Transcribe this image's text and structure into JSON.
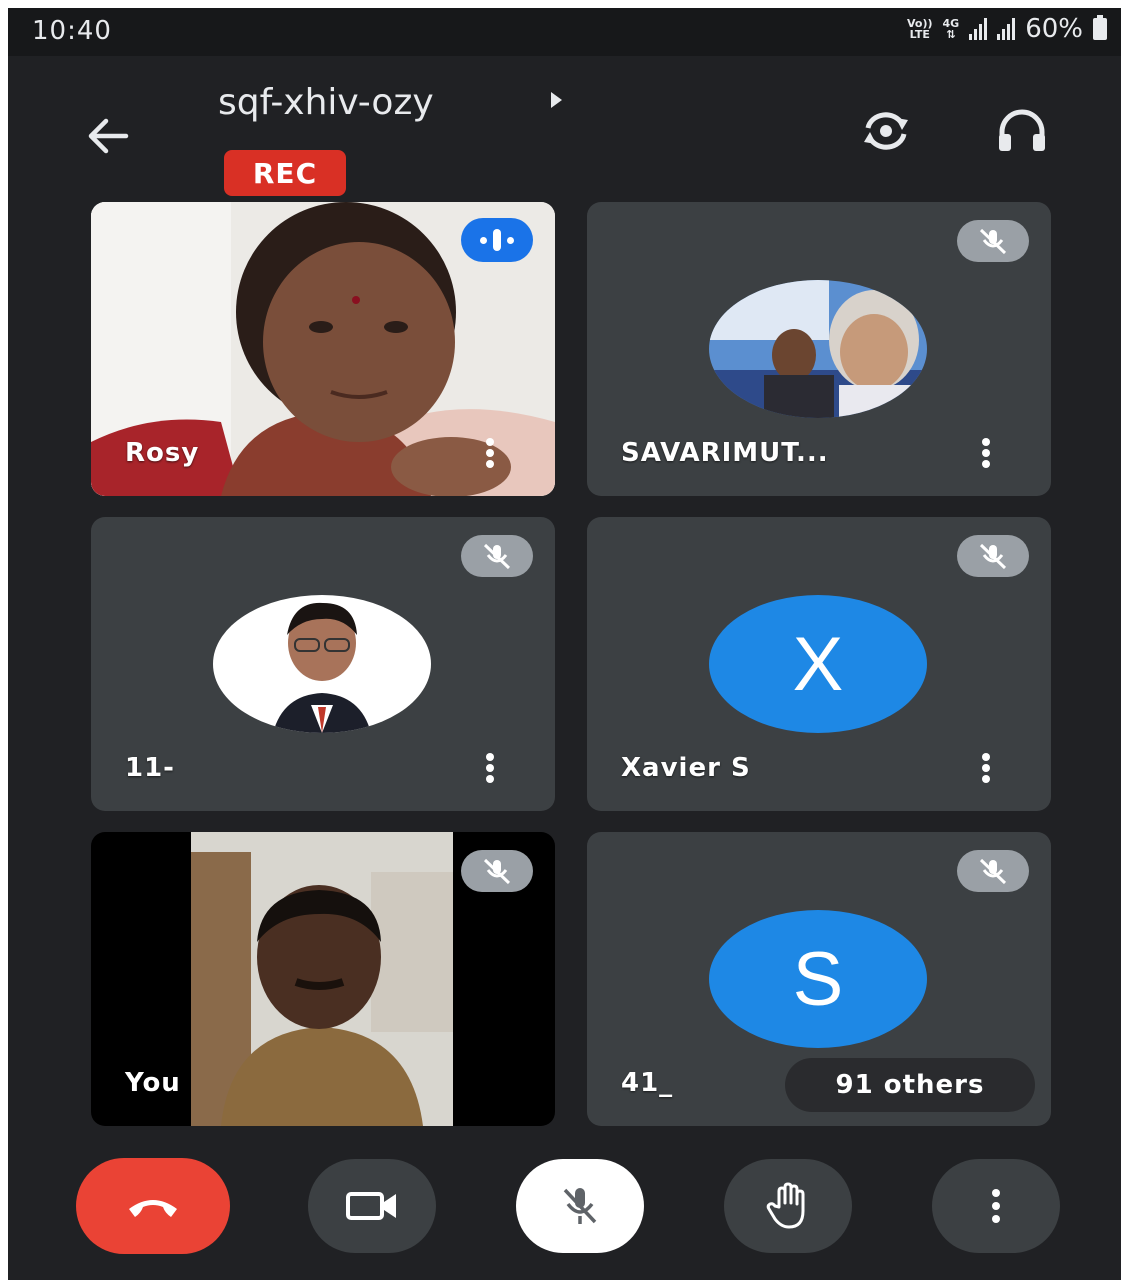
{
  "status_bar": {
    "time": "10:40",
    "volte_top": "Vo))",
    "volte_bottom": "LTE",
    "network": "4G",
    "battery": "60%"
  },
  "header": {
    "meeting_code": "sqf-xhiv-ozy",
    "rec_label": "REC"
  },
  "tiles": [
    {
      "name": "Rosy",
      "status": "speaking"
    },
    {
      "name": "SAVARIMUT...",
      "status": "muted"
    },
    {
      "name": "11-",
      "status": "muted"
    },
    {
      "name": "Xavier S",
      "status": "muted",
      "avatar_letter": "X"
    },
    {
      "name": "You",
      "status": "muted"
    },
    {
      "name": "41_",
      "status": "muted",
      "avatar_letter": "S",
      "others_label": "91 others"
    }
  ],
  "colors": {
    "background": "#202124",
    "tile": "#3c4043",
    "rec": "#d93025",
    "end_call": "#ea4335",
    "avatar_blue": "#1e88e5",
    "speaking": "#1a73e8"
  },
  "controls": [
    "end-call",
    "camera",
    "microphone-muted",
    "raise-hand",
    "more-options"
  ]
}
